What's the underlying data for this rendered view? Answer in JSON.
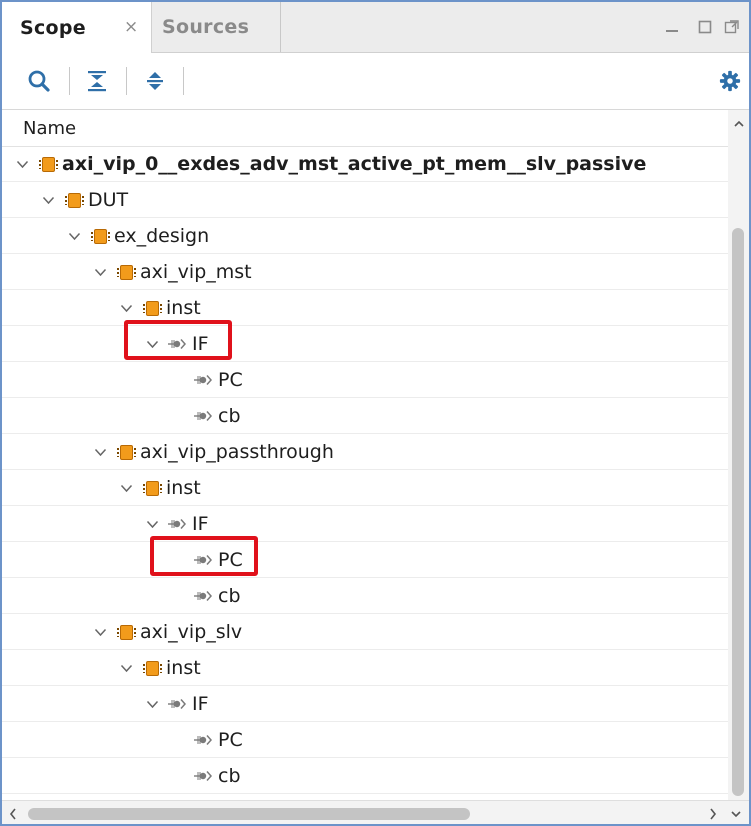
{
  "tabs": [
    {
      "label": "Scope",
      "active": true,
      "closable": true,
      "close_glyph": "×"
    },
    {
      "label": "Sources",
      "active": false
    }
  ],
  "window_controls": [
    "minimize-icon",
    "maximize-icon",
    "float-icon"
  ],
  "toolbar": {
    "buttons": [
      "search-icon",
      "collapse-all-icon",
      "expand-all-icon"
    ],
    "right_button": "gear-icon"
  },
  "tree": {
    "header": "Name",
    "rows": [
      {
        "label": "axi_vip_0__exdes_adv_mst_active_pt_mem__slv_passive",
        "level": 0,
        "icon": "module",
        "expanded": true,
        "bold": true
      },
      {
        "label": "DUT",
        "level": 1,
        "icon": "module",
        "expanded": true
      },
      {
        "label": "ex_design",
        "level": 2,
        "icon": "module",
        "expanded": true
      },
      {
        "label": "axi_vip_mst",
        "level": 3,
        "icon": "module",
        "expanded": true
      },
      {
        "label": "inst",
        "level": 4,
        "icon": "module",
        "expanded": true
      },
      {
        "label": "IF",
        "level": 5,
        "icon": "interface",
        "expanded": true,
        "highlighted": true
      },
      {
        "label": "PC",
        "level": 6,
        "icon": "interface",
        "expanded": null
      },
      {
        "label": "cb",
        "level": 6,
        "icon": "interface",
        "expanded": null
      },
      {
        "label": "axi_vip_passthrough",
        "level": 3,
        "icon": "module",
        "expanded": true
      },
      {
        "label": "inst",
        "level": 4,
        "icon": "module",
        "expanded": true
      },
      {
        "label": "IF",
        "level": 5,
        "icon": "interface",
        "expanded": true
      },
      {
        "label": "PC",
        "level": 6,
        "icon": "interface",
        "expanded": null,
        "highlighted": true
      },
      {
        "label": "cb",
        "level": 6,
        "icon": "interface",
        "expanded": null
      },
      {
        "label": "axi_vip_slv",
        "level": 3,
        "icon": "module",
        "expanded": true
      },
      {
        "label": "inst",
        "level": 4,
        "icon": "module",
        "expanded": true
      },
      {
        "label": "IF",
        "level": 5,
        "icon": "interface",
        "expanded": true
      },
      {
        "label": "PC",
        "level": 6,
        "icon": "interface",
        "expanded": null
      },
      {
        "label": "cb",
        "level": 6,
        "icon": "interface",
        "expanded": null
      }
    ]
  },
  "colors": {
    "accent": "#2f6fa8",
    "module_icon": "#f29b1b",
    "highlight_box": "#e0111b",
    "window_border": "#6c93c9"
  }
}
